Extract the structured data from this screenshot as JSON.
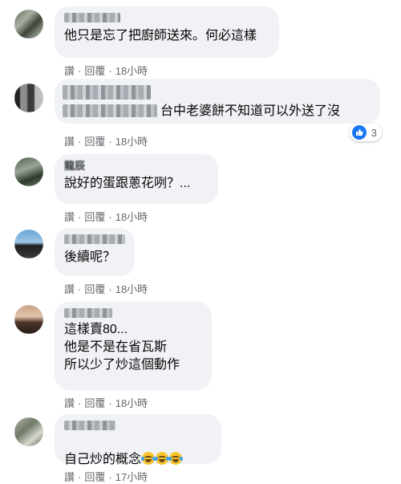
{
  "comments": [
    {
      "name": "",
      "text": "他只是忘了把廚師送來。何必這樣",
      "actions": {
        "like": "讚",
        "reply": "回覆",
        "time": "18小時"
      }
    },
    {
      "name": "",
      "text": "台中老婆餅不知道可以外送了沒",
      "actions": {
        "like": "讚",
        "reply": "回覆",
        "time": "18小時"
      },
      "reaction": {
        "icon": "like-icon",
        "count": "3"
      }
    },
    {
      "name": "龍辰",
      "text": "說好的蛋跟蔥花咧？...",
      "actions": {
        "like": "讚",
        "reply": "回覆",
        "time": "18小時"
      }
    },
    {
      "name": "",
      "text": "後續呢？",
      "actions": {
        "like": "讚",
        "reply": "回覆",
        "time": "18小時"
      }
    },
    {
      "name": "",
      "text": "這樣賣80...\n他是不是在省瓦斯\n所以少了炒這個動作",
      "actions": {
        "like": "讚",
        "reply": "回覆",
        "time": "18小時"
      }
    },
    {
      "name": "",
      "text": "自己炒的概念",
      "emoji": [
        "rolling-laughing-icon",
        "rolling-laughing-icon",
        "rolling-laughing-icon"
      ],
      "actions": {
        "like": "讚",
        "reply": "回覆",
        "time": "17小時"
      }
    }
  ],
  "separator": "·",
  "colors": {
    "bubble": "#f0f2f5",
    "meta": "#65676b",
    "like": "#1877f2"
  }
}
